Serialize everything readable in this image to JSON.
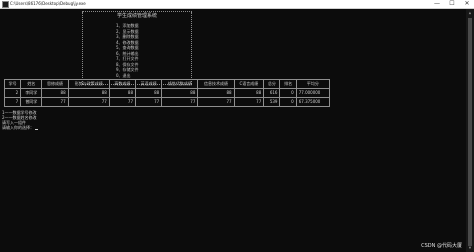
{
  "window": {
    "title": "C:\\Users\\86176\\Desktop\\Debug\\jy.exe",
    "minimize_glyph": "—",
    "maximize_glyph": "☐",
    "close_glyph": "✕"
  },
  "menu": {
    "title": "学生成绩管理系统",
    "items": [
      "1、添加数据",
      "2、显示数据",
      "3、删除数据",
      "4、修改数据",
      "5、查询数据",
      "6、统计输出",
      "7、打开文件",
      "8、保存文件",
      "9、存储文件",
      "0、退出"
    ]
  },
  "table": {
    "headers": [
      "学号",
      "姓名",
      "思修成绩",
      "形势与政策成绩",
      "高数成绩",
      "英语成绩",
      "线性代数成绩",
      "信息技术成绩",
      "C语言成绩",
      "总分",
      "排名",
      "平均分"
    ],
    "rows": [
      [
        "2",
        "李同学",
        "88",
        "88",
        "88",
        "88",
        "88",
        "88",
        "88",
        "616",
        "0",
        "77.000000"
      ],
      [
        "7",
        "曾同学",
        "77",
        "77",
        "77",
        "77",
        "77",
        "77",
        "77",
        "539",
        "0",
        "67.375000"
      ]
    ]
  },
  "prompts": [
    "1——数据学号修改",
    "2——数据姓名修改",
    "请写入一组件",
    "请输入你的选择："
  ],
  "watermark": "CSDN @代码大厦"
}
